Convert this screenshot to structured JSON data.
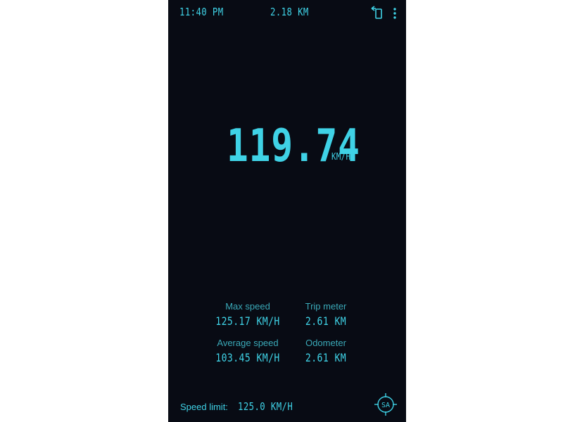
{
  "status_bar": {
    "time": "11:40 PM",
    "trip_distance": "2.18 KM"
  },
  "speedometer": {
    "speed": "119.74",
    "unit": "KM/H"
  },
  "stats": {
    "max_speed": {
      "label": "Max speed",
      "value": "125.17 KM/H"
    },
    "trip_meter": {
      "label": "Trip meter",
      "value": "2.61 KM"
    },
    "average_speed": {
      "label": "Average speed",
      "value": "103.45 KM/H"
    },
    "odometer": {
      "label": "Odometer",
      "value": "2.61 KM"
    }
  },
  "speed_limit": {
    "label": "Speed limit:",
    "value": "125.0 KM/H"
  },
  "gps_badge": {
    "text": "SA"
  },
  "icons": {
    "reset": "reset-icon",
    "menu": "more-vert-icon",
    "gps": "gps-target-icon"
  },
  "colors": {
    "background": "#080b14",
    "accent": "#3fd2e6",
    "label": "#3aa9b8"
  }
}
